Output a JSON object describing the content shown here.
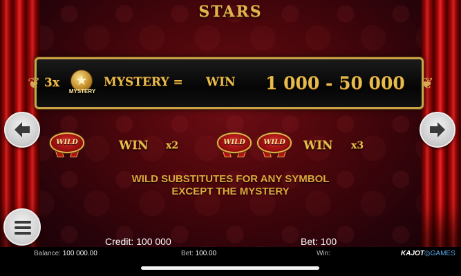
{
  "game": {
    "title": "STARS"
  },
  "mystery_line": {
    "multiplier": "3x",
    "coin_label": "MYSTERY",
    "mystery_text": "MYSTERY =",
    "win_label": "WIN",
    "range": "1 000 - 50 000"
  },
  "wild_rows": [
    {
      "symbol_label": "WILD",
      "count": 1,
      "win_label": "WIN",
      "multiplier": "x2"
    },
    {
      "symbol_label": "WILD",
      "count": 2,
      "win_label": "WIN",
      "multiplier": "x3"
    }
  ],
  "wild_note": {
    "line1": "WILD SUBSTITUTES FOR ANY SYMBOL",
    "line2": "EXCEPT THE MYSTERY"
  },
  "hud": {
    "credit": "Credit: 100 000",
    "bet": "Bet: 100"
  },
  "status": {
    "balance_label": "Balance:",
    "balance_value": "100 000.00",
    "bet_label": "Bet:",
    "bet_value": "100.00",
    "win_label": "Win:",
    "brand_main": "KAJOT",
    "brand_sub": "GAMES"
  },
  "icons": {
    "prev": "arrow-left-icon",
    "next": "arrow-right-icon",
    "menu": "hamburger-menu-icon"
  },
  "colors": {
    "gold": "#e8bb4d",
    "note": "#e0a83c",
    "background": "#4a060b"
  }
}
